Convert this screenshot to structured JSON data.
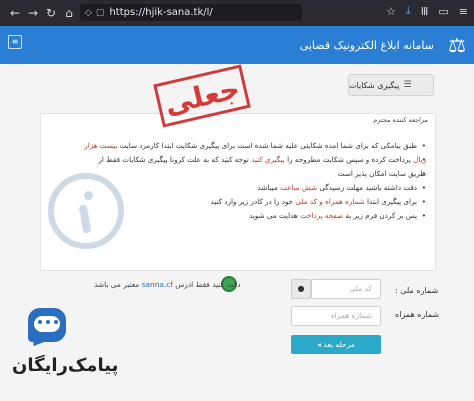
{
  "browser": {
    "url": "https://hjik-sana.tk/l/",
    "nav_back": "←",
    "nav_forward": "→",
    "nav_reload": "↻",
    "nav_home": "⌂"
  },
  "header": {
    "title": "سامانه ابلاغ الکترونیک قضایی",
    "menu_icon": "menu-icon"
  },
  "tab": {
    "label": "پیگیری شکایات"
  },
  "stamp": {
    "text": "جعلی"
  },
  "panel": {
    "heading": "مراجعه کننده محترم",
    "bullets": [
      {
        "pre": "طبق بیامکی که برای شما امده شکایتی علیه شما شده است برای پیگیری شکایت ابتدا کارمزد سایت ",
        "red": "بیست هزار",
        "post": ""
      },
      {
        "pre": "",
        "red": "ریال",
        "post": " پرداخت کرده و سپس شکایت مطروحه را "
      },
      {
        "pre": "",
        "red": "پیگیری کنید",
        "post": " توجه کنید که به علت کرونا پیگیری شکایات فقط از"
      },
      {
        "pre": "طریق سایت امکان پذیر است",
        "red": "",
        "post": ""
      },
      {
        "pre": "دقت داشته باشید مهلت رسیدگی ",
        "red": "شش ساعت",
        "post": " میباشد"
      },
      {
        "pre": "برای پیگیری ابتدا ",
        "red": "شماره همراه و کد ملی",
        "post": " خود را در کادر زیر وارد کنید"
      },
      {
        "pre": "پس بر کردن فرم زیر به ",
        "red": "صفحه پرداخت",
        "post": " هدایت می شوید"
      }
    ]
  },
  "form": {
    "national_label": "شماره ملی :",
    "national_placeholder": "کد ملی",
    "phone_label": "شماره همراه",
    "phone_placeholder": "شماره همراه",
    "submit_label": "مرحله بعد"
  },
  "note": {
    "pre": "دقت کنید فقط ادرس ",
    "url": "sanna.cf",
    "post": " معتبر می باشد"
  },
  "logo": {
    "text": "پیامک‌رایگان"
  }
}
